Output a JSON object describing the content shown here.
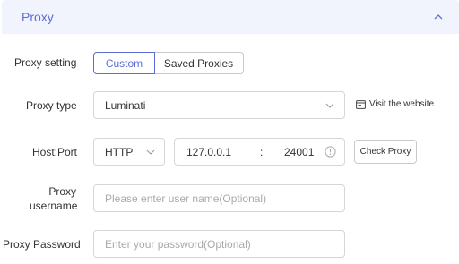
{
  "section": {
    "title": "Proxy"
  },
  "proxy_setting": {
    "label": "Proxy setting",
    "options": [
      "Custom",
      "Saved Proxies"
    ],
    "selected": "Custom"
  },
  "proxy_type": {
    "label": "Proxy type",
    "value": "Luminati",
    "link_label": "Visit the website"
  },
  "host_port": {
    "label": "Host:Port",
    "protocol": "HTTP",
    "host": "127.0.0.1",
    "separator": ":",
    "port": "24001",
    "check_button": "Check Proxy"
  },
  "username": {
    "label_line1": "Proxy",
    "label_line2": "username",
    "placeholder": "Please enter user name(Optional)"
  },
  "password": {
    "label": "Proxy Password",
    "placeholder": "Enter your password(Optional)"
  },
  "colors": {
    "accent": "#5a6dd8",
    "header_bg": "#f1f3fd",
    "border": "#d6d6d6",
    "placeholder": "#aaaaaa"
  }
}
